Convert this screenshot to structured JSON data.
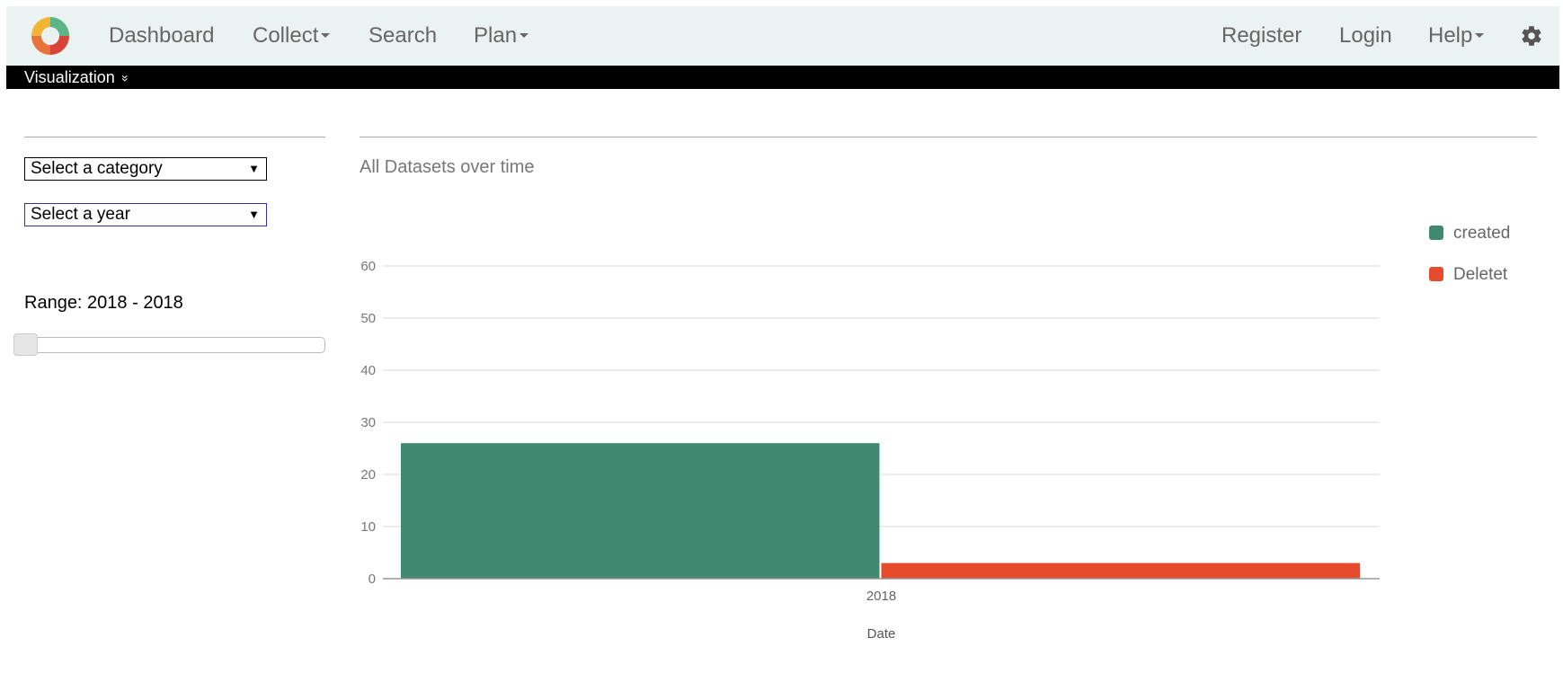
{
  "navbar": {
    "logo_icon": "logo-icon",
    "items_left": [
      {
        "label": "Dashboard",
        "dropdown": false
      },
      {
        "label": "Collect",
        "dropdown": true
      },
      {
        "label": "Search",
        "dropdown": false
      },
      {
        "label": "Plan",
        "dropdown": true
      }
    ],
    "items_right": [
      {
        "label": "Register",
        "dropdown": false
      },
      {
        "label": "Login",
        "dropdown": false
      },
      {
        "label": "Help",
        "dropdown": true
      }
    ],
    "settings_icon": "gear-icon"
  },
  "vizbar": {
    "label": "Visualization",
    "icon": "double-chevron-down-icon",
    "glyph": "»"
  },
  "filters": {
    "category_select": "Select a category",
    "year_select": "Select a year",
    "select_arrow": "▼",
    "range_label": "Range: 2018 - 2018"
  },
  "colors": {
    "nav_bg": "#eaf3f1",
    "created": "#418870",
    "deleted": "#e64b2d"
  },
  "chart_data": {
    "type": "bar",
    "title": "All Datasets over time",
    "xlabel": "Date",
    "ylabel": "",
    "categories": [
      "2018"
    ],
    "series": [
      {
        "name": "created",
        "values": [
          26
        ],
        "color": "#418870"
      },
      {
        "name": "Deletet",
        "values": [
          3
        ],
        "color": "#e64b2d"
      }
    ],
    "ylim": [
      0,
      60
    ],
    "yticks": [
      0,
      10,
      20,
      30,
      40,
      50,
      60
    ],
    "grid": true,
    "legend": "right"
  }
}
